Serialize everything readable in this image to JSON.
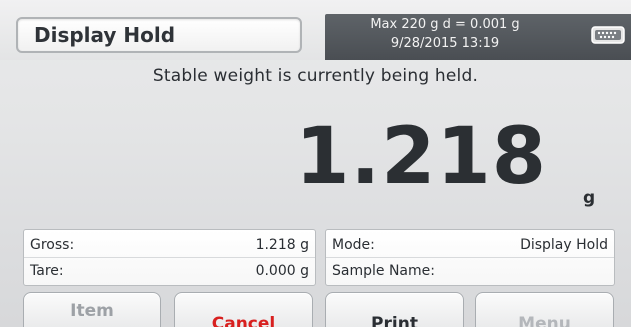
{
  "header": {
    "title": "Display Hold",
    "capacity": "Max 220 g  d = 0.001 g",
    "datetime": "9/28/2015  13:19",
    "port_icon": "serial-port-icon"
  },
  "status_message": "Stable weight is currently being held.",
  "reading": {
    "value": "1.218",
    "unit": "g"
  },
  "left_panel": {
    "gross_label": "Gross:",
    "gross_value": "1.218 g",
    "tare_label": "Tare:",
    "tare_value": "0.000 g"
  },
  "right_panel": {
    "mode_label": "Mode:",
    "mode_value": "Display Hold",
    "sample_label": "Sample Name:",
    "sample_value": ""
  },
  "buttons": {
    "item": "Item",
    "cancel": "Cancel",
    "print": "Print",
    "menu": "Menu"
  },
  "colors": {
    "cancel_text": "#d8201f",
    "header_info_bg": "#55595e"
  }
}
